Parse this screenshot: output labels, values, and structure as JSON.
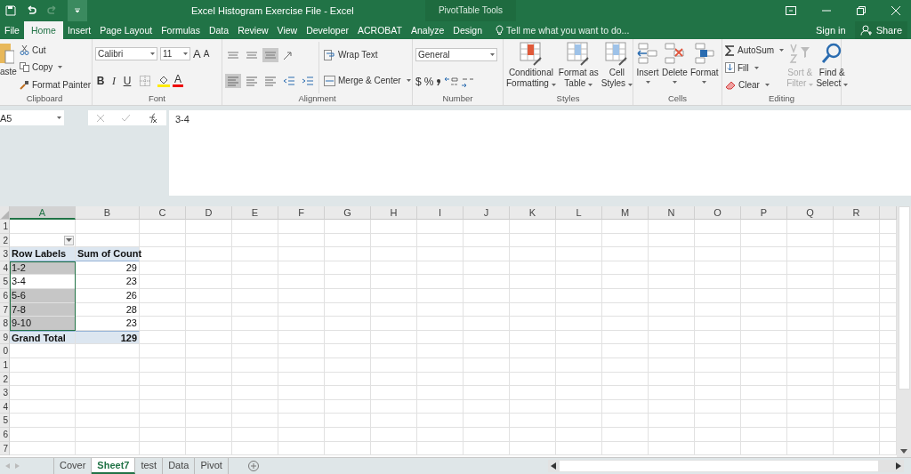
{
  "window": {
    "title": "Excel Histogram Exercise File - Excel",
    "contextual": "PivotTable Tools"
  },
  "tabs": [
    {
      "label": "File",
      "selected": false
    },
    {
      "label": "Home",
      "selected": true
    },
    {
      "label": "Insert",
      "selected": false
    },
    {
      "label": "Page Layout",
      "selected": false
    },
    {
      "label": "Formulas",
      "selected": false
    },
    {
      "label": "Data",
      "selected": false
    },
    {
      "label": "Review",
      "selected": false
    },
    {
      "label": "View",
      "selected": false
    },
    {
      "label": "Developer",
      "selected": false
    },
    {
      "label": "ACROBAT",
      "selected": false
    },
    {
      "label": "Analyze",
      "selected": false
    },
    {
      "label": "Design",
      "selected": false
    }
  ],
  "tell_me": {
    "placeholder": "Tell me what you want to do..."
  },
  "sign_in": "Sign in",
  "share": "Share",
  "ribbon": {
    "clipboard": {
      "label": "Clipboard",
      "paste": "aste",
      "cut": "Cut",
      "copy": "Copy",
      "format_painter": "Format Painter"
    },
    "font": {
      "label": "Font",
      "family": "Calibri",
      "size": "11",
      "grow": "A",
      "shrink": "A",
      "bold": "B",
      "italic": "I",
      "underline": "U",
      "font_color": "A"
    },
    "alignment": {
      "label": "Alignment",
      "wrap_text": "Wrap Text",
      "merge_center": "Merge & Center"
    },
    "number": {
      "label": "Number",
      "format": "General",
      "currency": "$",
      "percent": "%"
    },
    "styles": {
      "label": "Styles",
      "items": [
        {
          "lines": [
            "Conditional",
            "Formatting"
          ]
        },
        {
          "lines": [
            "Format as",
            "Table"
          ]
        },
        {
          "lines": [
            "Cell",
            "Styles"
          ]
        }
      ]
    },
    "cells": {
      "label": "Cells",
      "items": [
        {
          "label": "Insert"
        },
        {
          "label": "Delete"
        },
        {
          "label": "Format"
        }
      ]
    },
    "editing": {
      "label": "Editing",
      "autosum": "AutoSum",
      "fill": "Fill",
      "clear": "Clear",
      "big": [
        {
          "lines": [
            "Sort &",
            "Filter"
          ],
          "disabled": true
        },
        {
          "lines": [
            "Find &",
            "Select"
          ],
          "disabled": false
        }
      ]
    }
  },
  "name_box": "A5",
  "formula": "3-4",
  "columns": [
    {
      "label": "A",
      "selected": true
    },
    {
      "label": "B",
      "selected": false
    },
    {
      "label": "C",
      "selected": false
    },
    {
      "label": "D",
      "selected": false
    },
    {
      "label": "E",
      "selected": false
    },
    {
      "label": "F",
      "selected": false
    },
    {
      "label": "G",
      "selected": false
    },
    {
      "label": "H",
      "selected": false
    },
    {
      "label": "I",
      "selected": false
    },
    {
      "label": "J",
      "selected": false
    },
    {
      "label": "K",
      "selected": false
    },
    {
      "label": "L",
      "selected": false
    },
    {
      "label": "M",
      "selected": false
    },
    {
      "label": "N",
      "selected": false
    },
    {
      "label": "O",
      "selected": false
    },
    {
      "label": "P",
      "selected": false
    },
    {
      "label": "Q",
      "selected": false
    },
    {
      "label": "R",
      "selected": false
    }
  ],
  "row_headers": [
    "1",
    "2",
    "3",
    "4",
    "5",
    "6",
    "7",
    "8",
    "9",
    "0",
    "1",
    "2",
    "3",
    "4",
    "5",
    "6",
    "7"
  ],
  "pivot": {
    "header": "Row Labels",
    "value_header": "Sum of Count",
    "rows": [
      {
        "label": "1-2",
        "count": "29",
        "selected": true
      },
      {
        "label": "3-4",
        "count": "23",
        "selected": false
      },
      {
        "label": "5-6",
        "count": "26",
        "selected": true
      },
      {
        "label": "7-8",
        "count": "28",
        "selected": true
      },
      {
        "label": "9-10",
        "count": "23",
        "selected": true
      }
    ],
    "total_label": "Grand Total",
    "total": "129"
  },
  "sheets": [
    {
      "label": "Cover",
      "selected": false
    },
    {
      "label": "Sheet7",
      "selected": true
    },
    {
      "label": "test",
      "selected": false
    },
    {
      "label": "Data",
      "selected": false
    },
    {
      "label": "Pivot",
      "selected": false
    }
  ]
}
